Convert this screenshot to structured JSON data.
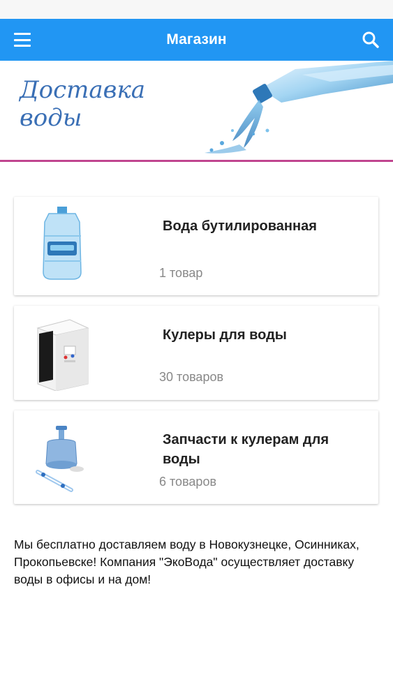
{
  "app_bar": {
    "title": "Магазин",
    "menu_icon": "hamburger-menu-icon",
    "search_icon": "search-icon",
    "color": "#2196f3"
  },
  "banner": {
    "text_line1": "Доставка",
    "text_line2": "воды",
    "accent_color": "#c0458f"
  },
  "categories": [
    {
      "title": "Вода бутилированная",
      "count": "1 товар",
      "icon": "water-bottle-image"
    },
    {
      "title": "Кулеры для воды",
      "count": "30 товаров",
      "icon": "water-cooler-image"
    },
    {
      "title": "Запчасти к кулерам для воды",
      "count": "6 товаров",
      "icon": "water-pump-parts-image"
    }
  ],
  "footer": {
    "text": "Мы бесплатно доставляем воду в Новокузнецке, Осинниках, Прокопьевске! Компания \"ЭкоВода\" осуществляет доставку воды в офисы и на дом!"
  }
}
